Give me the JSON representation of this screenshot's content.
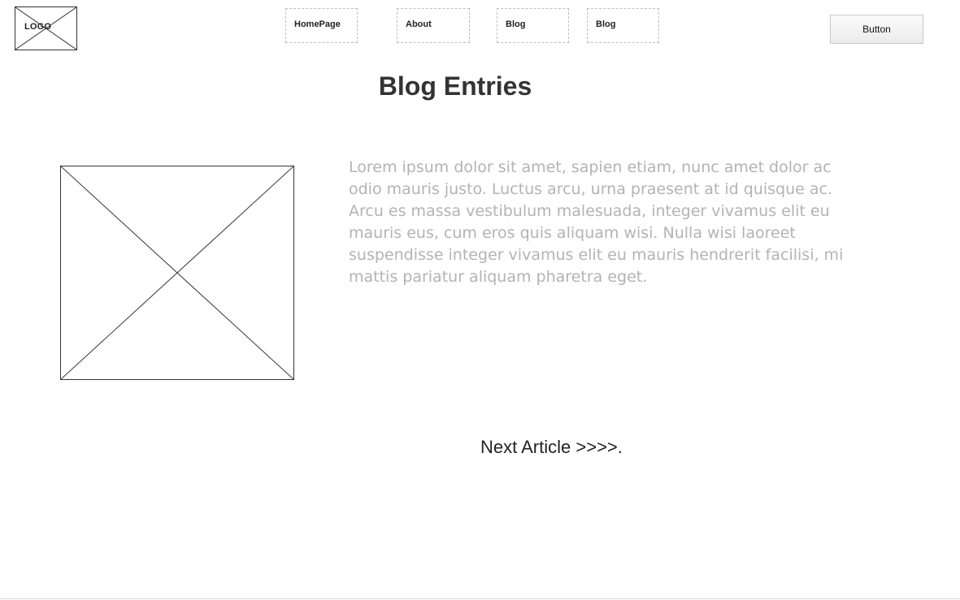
{
  "header": {
    "logo_text": "LOGO",
    "nav": [
      {
        "label": "HomePage"
      },
      {
        "label": "About"
      },
      {
        "label": "Blog"
      },
      {
        "label": "Blog"
      }
    ],
    "button_label": "Button"
  },
  "main": {
    "title": "Blog Entries",
    "image_placeholder_icon": "image-placeholder-icon",
    "body_text": "Lorem ipsum dolor sit amet, sapien etiam, nunc amet dolor ac odio mauris justo. Luctus arcu, urna praesent at id quisque ac. Arcu es massa vestibulum malesuada, integer vivamus elit eu mauris eus, cum eros quis aliquam wisi. Nulla wisi laoreet suspendisse integer vivamus elit eu mauris hendrerit facilisi, mi mattis pariatur aliquam pharetra eget.",
    "next_link": "Next Article >>>>."
  },
  "colors": {
    "text_dark": "#333333",
    "text_muted": "#b3b3b3",
    "placeholder_border": "#bdbdbd"
  }
}
